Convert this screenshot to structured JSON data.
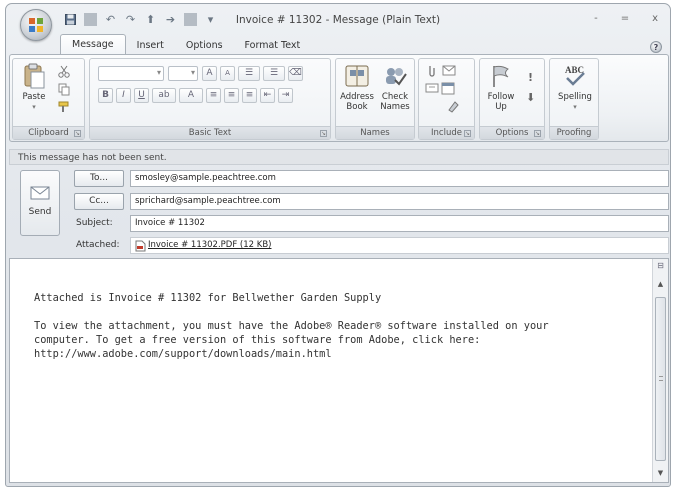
{
  "window": {
    "title": "Invoice # 11302 - Message (Plain Text)",
    "controls": {
      "minimize": "-",
      "maximize": "=",
      "close": "x"
    }
  },
  "quick_access": {
    "icons": [
      "save-icon",
      "undo-icon",
      "redo-icon",
      "up-arrow-icon",
      "down-arrow-icon",
      "customize-icon"
    ]
  },
  "tabs": [
    "Message",
    "Insert",
    "Options",
    "Format Text"
  ],
  "ribbon": {
    "groups": {
      "clipboard": {
        "label": "Clipboard",
        "paste_label": "Paste"
      },
      "basic_text": {
        "label": "Basic Text"
      },
      "names": {
        "label": "Names",
        "address_book_label": "Address Book",
        "check_names_label": "Check Names"
      },
      "include": {
        "label": "Include"
      },
      "options": {
        "label": "Options",
        "follow_up_label": "Follow Up"
      },
      "proofing": {
        "label": "Proofing",
        "spelling_label": "Spelling"
      }
    }
  },
  "info_bar": "This message has not been sent.",
  "header": {
    "send_label": "Send",
    "to_button": "To...",
    "cc_button": "Cc...",
    "to_value": "smosley@sample.peachtree.com",
    "cc_value": "sprichard@sample.peachtree.com",
    "subject_label": "Subject:",
    "subject_value": "Invoice # 11302",
    "attached_label": "Attached:",
    "attachment_name": "Invoice # 11302.PDF (12 KB)"
  },
  "body": {
    "line1": "Attached is Invoice # 11302 for Bellwether Garden Supply",
    "line2": "To view the attachment, you must have the Adobe® Reader® software installed on your",
    "line3": "computer. To get a free version of this software from Adobe, click here:",
    "line4": "http://www.adobe.com/support/downloads/main.html"
  },
  "colors": {
    "accent": "#2a62a8",
    "ribbon_bg": "#eef1f4",
    "window_frame": "#9ea6ae"
  }
}
